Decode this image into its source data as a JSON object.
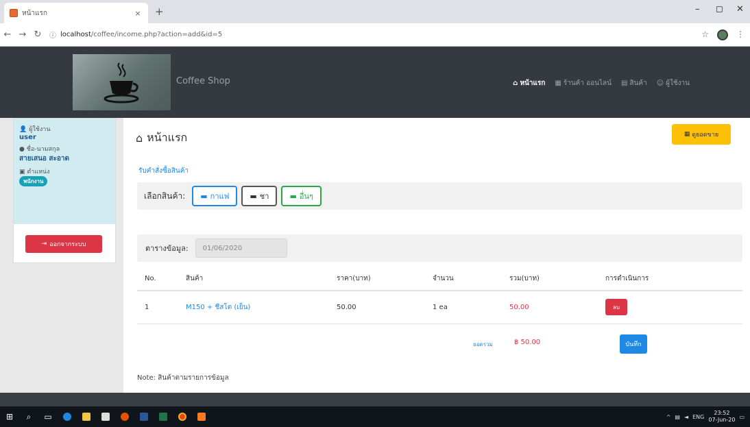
{
  "browser": {
    "tab_title": "หน้าแรก",
    "url_host": "localhost",
    "url_path": "/coffee/income.php?action=add&id=5",
    "new_tab": "+",
    "tab_close": "×"
  },
  "navbar": {
    "brand": "Coffee Shop",
    "links": [
      {
        "label": "หน้าแรก",
        "icon": "home-icon",
        "active": true
      },
      {
        "label": "ร้านค้า ออนไลน์",
        "icon": "store-icon",
        "active": false
      },
      {
        "label": "สินค้า",
        "icon": "products-icon",
        "active": false
      },
      {
        "label": "ผู้ใช้งาน",
        "icon": "users-icon",
        "active": false
      }
    ]
  },
  "sidebar": {
    "user_label": "ผู้ใช้งาน",
    "user_value": "user",
    "name_label": "ชื่อ-นามสกุล",
    "name_value": "สายเสนอ สะอาด",
    "role_label": "ตำแหน่ง",
    "role_badge": "พนักงาน",
    "logout_label": "ออกจากระบบ"
  },
  "main": {
    "title": "หน้าแรก",
    "report_button": "ดูยอดขาย",
    "section_title": "รับคำสั่งซื้อสินค้า",
    "choose_label": "เลือกสินค้า:",
    "product_buttons": [
      "กาแฟ",
      "ชา",
      "อื่นๆ"
    ],
    "date_label": "ตารางข้อมูล:",
    "date_value": "01/06/2020",
    "table": {
      "headers": [
        "No.",
        "สินค้า",
        "ราคา(บาท)",
        "จำนวน",
        "รวม(บาท)",
        "การดำเนินการ"
      ],
      "rows": [
        {
          "no": "1",
          "product": "M150 + ชีสโต (เย็น)",
          "price": "50.00",
          "qty": "1 ea",
          "total": "50.00",
          "action": "ลบ"
        }
      ]
    },
    "sum_label": "ยอดรวม",
    "sum_value": "฿ 50.00",
    "save_button": "บันทึก",
    "note": "Note: สินค้าตามรายการข้อมูล"
  },
  "taskbar": {
    "language": "ENG",
    "time": "23:52",
    "date": "07-Jun-20"
  },
  "colors": {
    "navbar": "#343a40",
    "primary": "#1e88e5",
    "danger": "#dc3545",
    "warning": "#ffc107",
    "success": "#28a745",
    "info_bg": "#d1ecf1"
  }
}
